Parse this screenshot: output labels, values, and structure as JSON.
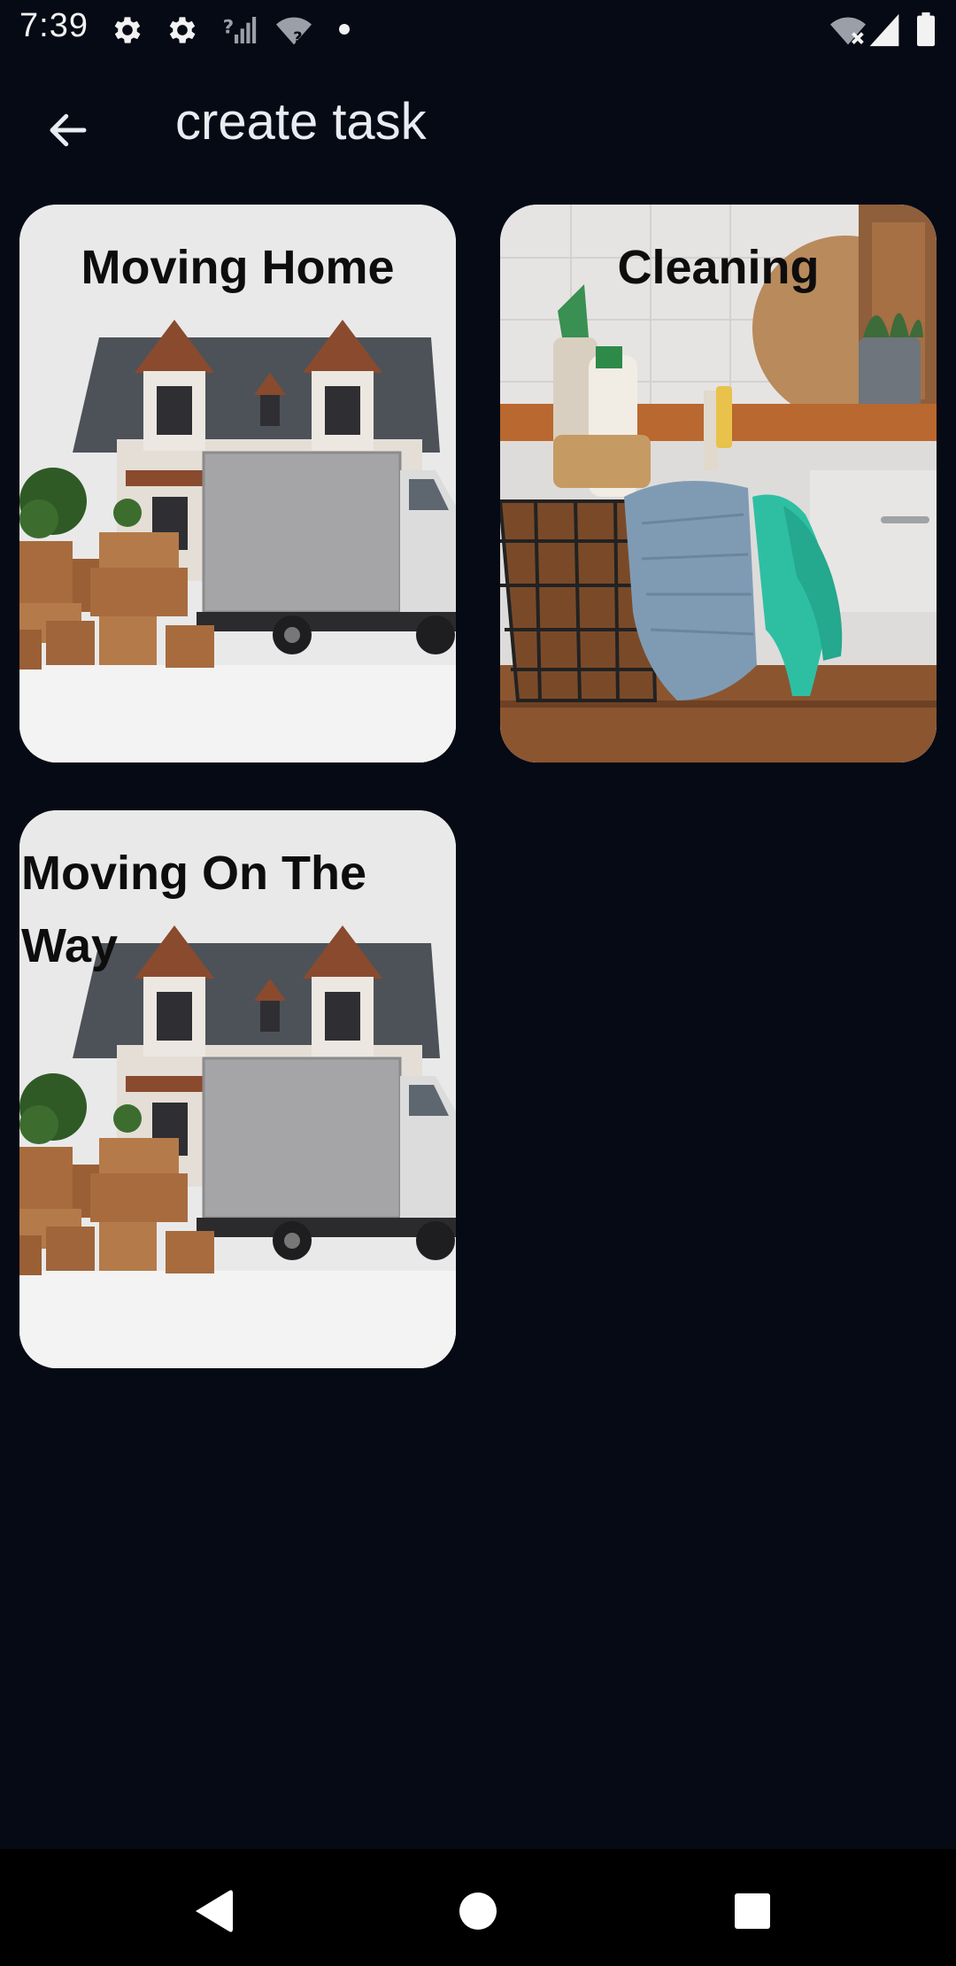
{
  "status_bar": {
    "time": "7:39",
    "left_icons": [
      "gear-icon",
      "gear-icon",
      "no-signal-icon",
      "wifi-question-icon",
      "dot-icon"
    ],
    "right_icons": [
      "wifi-x-icon",
      "cell-signal-icon",
      "battery-icon"
    ]
  },
  "app_bar": {
    "back_icon": "arrow-left-icon",
    "title": "create task"
  },
  "cards": [
    {
      "title": "Moving Home",
      "image": "house-with-moving-truck-and-boxes"
    },
    {
      "title": "Cleaning",
      "image": "cleaning-basket-with-towel-and-gloves"
    },
    {
      "title": "Moving On The Way",
      "image": "house-with-moving-truck-and-boxes"
    }
  ],
  "nav_bar": {
    "back_icon": "triangle-back-icon",
    "home_icon": "circle-home-icon",
    "recents_icon": "square-recents-icon"
  },
  "colors": {
    "background": "#060a14",
    "card_background": "#e9e9ea",
    "nav_background": "#000000"
  }
}
